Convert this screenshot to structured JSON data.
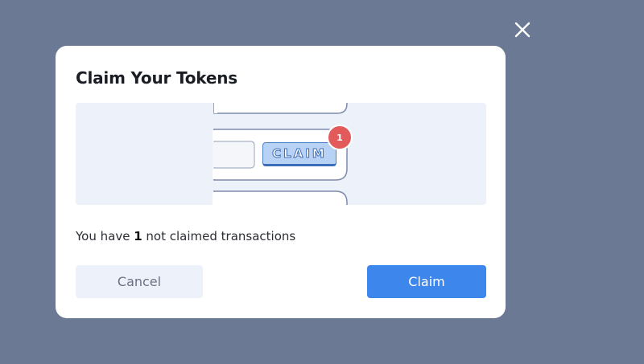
{
  "modal": {
    "title": "Claim Your Tokens",
    "message_prefix": "You have ",
    "unclaimed_count": "1",
    "message_suffix": " not claimed transactions",
    "cancel_label": "Cancel",
    "claim_label": "Claim",
    "close_icon": "close-icon"
  },
  "illustration": {
    "claim_button_text": "CLAIM",
    "badge_count": "1"
  },
  "colors": {
    "overlay": "#6b7994",
    "primary": "#3d86ec",
    "badge": "#e35a5a",
    "secondary_bg": "#edf1f9"
  }
}
